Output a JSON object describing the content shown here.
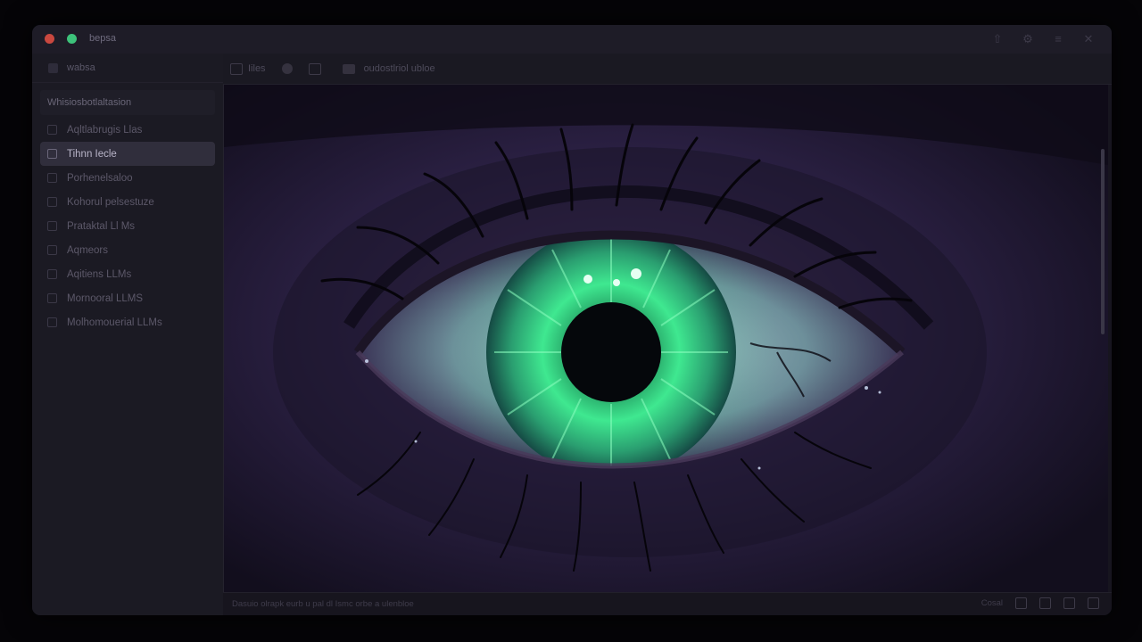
{
  "window": {
    "title": "bepsa"
  },
  "titlebar_icons": [
    "upload-icon",
    "settings-icon",
    "menu-icon",
    "close-icon"
  ],
  "sidebar": {
    "header": "wabsa",
    "group_label": "Whisiosbotlaltasion",
    "items": [
      {
        "label": "Aqltlabrugis Llas",
        "active": false
      },
      {
        "label": "Tihnn Iecle",
        "active": true
      },
      {
        "label": "Porhenelsaloo",
        "active": false
      },
      {
        "label": "Kohorul pelsestuze",
        "active": false
      },
      {
        "label": "Prataktal Ll Ms",
        "active": false
      },
      {
        "label": "Aqmeors",
        "active": false
      },
      {
        "label": "Aqitiens LLMs",
        "active": false
      },
      {
        "label": "Mornooral LLMS",
        "active": false
      },
      {
        "label": "Molhomouerial LLMs",
        "active": false
      }
    ]
  },
  "toolbar": {
    "file_label": "Iiles",
    "filename": "oudostlriol ubloe"
  },
  "image": {
    "subject": "close-up eye with glowing green digital iris",
    "colors": {
      "iris": "#3fe890",
      "skin": "#2a1f44",
      "pupil": "#06080c",
      "sclera": "#7fa6ae"
    }
  },
  "statusbar": {
    "text": "Dasuio olrapk eurb u pal dl Ismc orbe a ulenbloe",
    "right_label": "Cosal"
  }
}
